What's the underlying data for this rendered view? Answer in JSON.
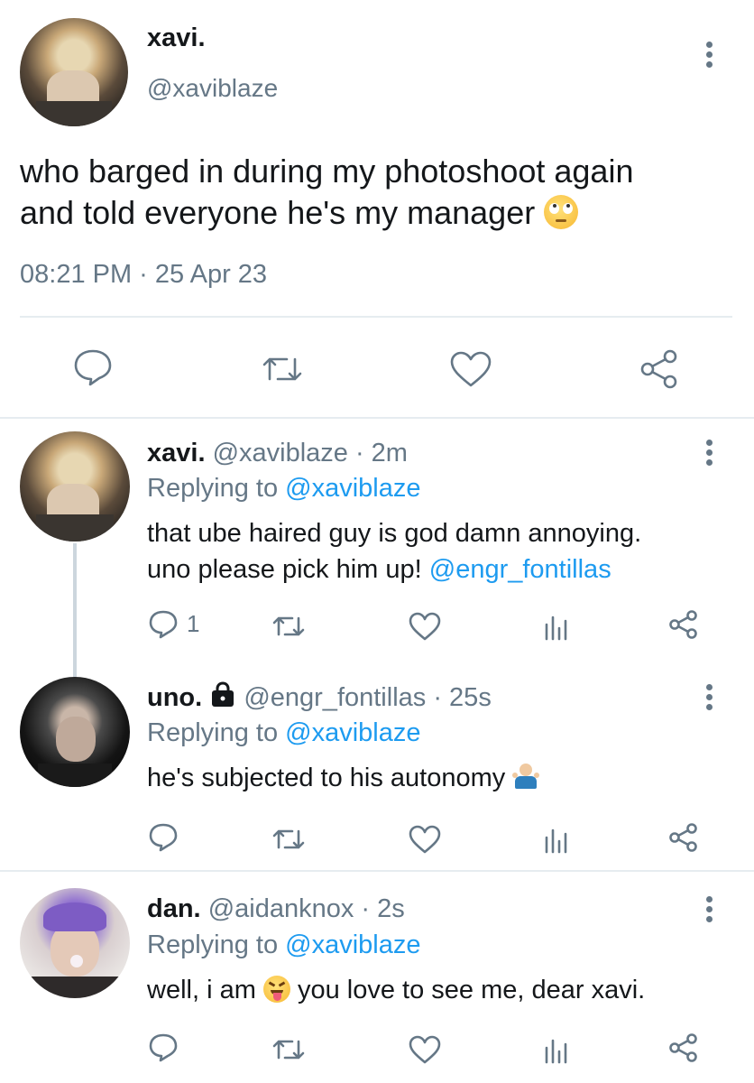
{
  "main_tweet": {
    "display_name": "xavi.",
    "handle": "@xaviblaze",
    "text_line1": "who barged in during my photoshoot again",
    "text_line2": "and told everyone he's my manager",
    "emoji_icon": "face-with-rolling-eyes",
    "timestamp": "08:21 PM · 25 Apr 23",
    "actions": [
      "reply-icon",
      "retweet-icon",
      "like-icon",
      "share-icon"
    ]
  },
  "replies": [
    {
      "display_name": "xavi.",
      "handle": "@xaviblaze",
      "time": "· 2m",
      "replying_prefix": "Replying to",
      "replying_to": "@xaviblaze",
      "text_line1": "that ube haired guy is god damn annoying.",
      "text_line2_prefix": "uno please pick him up!",
      "text_line2_mention": "@engr_fontillas",
      "reply_count": "1"
    },
    {
      "display_name": "uno.",
      "locked": true,
      "handle": "@engr_fontillas",
      "time": "· 25s",
      "replying_prefix": "Replying to",
      "replying_to": "@xaviblaze",
      "text": "he's subjected to his autonomy",
      "emoji_icon": "person-shrugging"
    },
    {
      "display_name": "dan.",
      "handle": "@aidanknox",
      "time": "· 2s",
      "replying_prefix": "Replying to",
      "replying_to": "@xaviblaze",
      "text_before": "well, i am",
      "emoji_icon": "squinting-face-with-tongue",
      "text_after": "you love to see me, dear xavi."
    }
  ],
  "colors": {
    "link": "#1d9bf0",
    "secondary": "#657786",
    "text": "#14171a",
    "divider": "#e6ecf0"
  }
}
